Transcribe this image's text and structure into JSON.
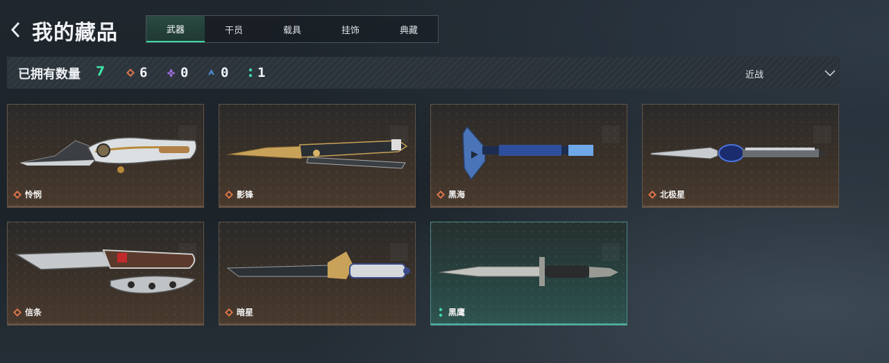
{
  "header": {
    "title": "我的藏品",
    "tabs": [
      {
        "label": "武器",
        "active": true
      },
      {
        "label": "干员",
        "active": false
      },
      {
        "label": "载具",
        "active": false
      },
      {
        "label": "挂饰",
        "active": false
      },
      {
        "label": "典藏",
        "active": false
      }
    ]
  },
  "stats": {
    "owned_label": "已拥有数量",
    "owned_count": "7",
    "rarity_counts": [
      {
        "icon": "orange-diamond-icon",
        "color": "#d9744a",
        "count": "6"
      },
      {
        "icon": "purple-diamond-icon",
        "color": "#9b6bd8",
        "count": "0"
      },
      {
        "icon": "blue-triangle-icon",
        "color": "#4f8ed6",
        "count": "0"
      },
      {
        "icon": "green-dots-icon",
        "color": "#3fd9a4",
        "count": "1"
      }
    ],
    "filter_label": "近战"
  },
  "items": [
    {
      "name": "怜悯",
      "rarity": "orange"
    },
    {
      "name": "影锋",
      "rarity": "orange"
    },
    {
      "name": "黑海",
      "rarity": "orange"
    },
    {
      "name": "北极星",
      "rarity": "orange"
    },
    {
      "name": "信条",
      "rarity": "orange"
    },
    {
      "name": "暗星",
      "rarity": "orange"
    },
    {
      "name": "黑鹰",
      "rarity": "green"
    }
  ],
  "colors": {
    "accent_green": "#3fe0a5",
    "rarity_orange": "#d9744a",
    "rarity_green": "#3fd9a4"
  }
}
